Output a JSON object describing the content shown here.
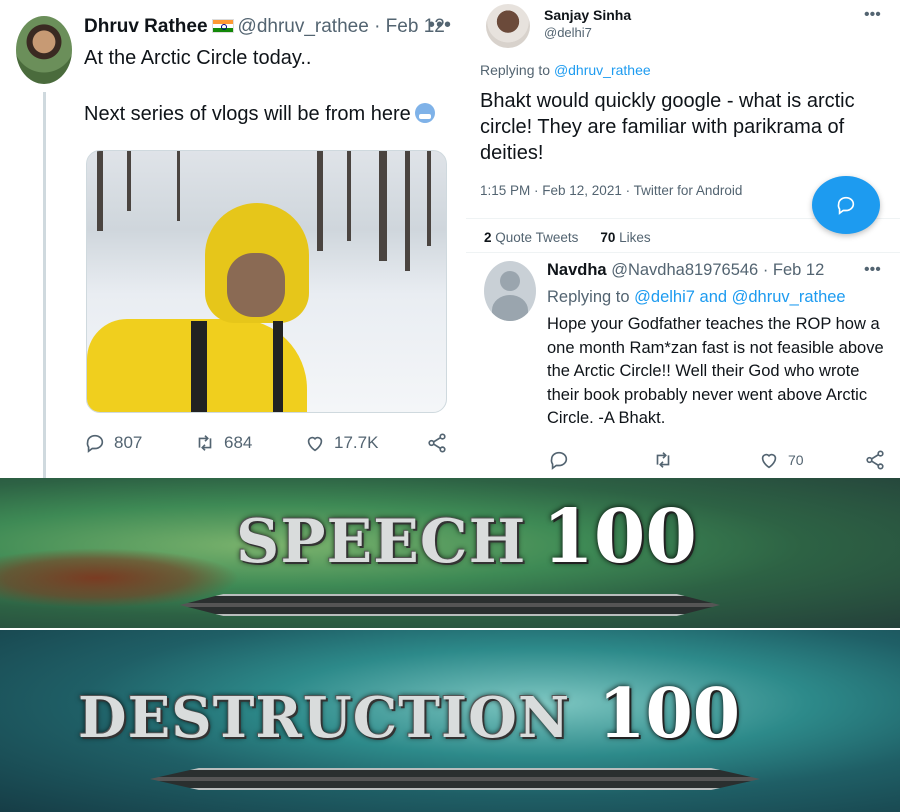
{
  "tweet_left": {
    "name": "Dhruv Rathee",
    "handle_date": "@dhruv_rathee · Feb 12",
    "more": "•••",
    "text_line1": "At the Arctic Circle today..",
    "text_line2": "Next series of vlogs will be from here",
    "actions": {
      "replies": "807",
      "retweets": "684",
      "likes": "17.7K"
    }
  },
  "tweet_reply": {
    "name": "Sanjay Sinha",
    "handle": "@delhi7",
    "more": "•••",
    "replying_prefix": "Replying to ",
    "replying_to": "@dhruv_rathee",
    "text": "Bhakt would quickly google - what is arctic circle! They are familiar with parikrama of deities!",
    "meta": "1:15 PM · Feb 12, 2021 · Twitter for Android",
    "quote_count": "2",
    "quote_label": "Quote Tweets",
    "like_count": "70",
    "like_label": "Likes"
  },
  "tweet_response": {
    "name": "Navdha",
    "handle_date": "@Navdha81976546 · Feb 12",
    "more": "•••",
    "replying_prefix": "Replying to ",
    "replying_to": "@delhi7 and @dhruv_rathee",
    "text": "Hope your Godfather teaches the ROP how a one month Ram*zan fast is not feasible above the Arctic Circle!! Well their God who wrote their book probably never went above Arctic Circle. -A Bhakt.",
    "actions": {
      "likes": "70"
    }
  },
  "meme": {
    "skill1_label": "SPEECH",
    "skill1_value": "100",
    "skill2_label": "DESTRUCTION",
    "skill2_value": "100"
  },
  "colors": {
    "twitter_blue": "#1d9bf0",
    "secondary_text": "#536471"
  }
}
